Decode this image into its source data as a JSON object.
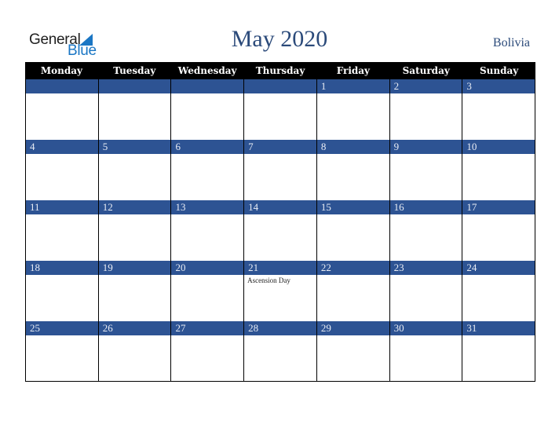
{
  "logo": {
    "general": "General",
    "blue": "Blue"
  },
  "title": "May 2020",
  "country": "Bolivia",
  "weekdays": [
    "Monday",
    "Tuesday",
    "Wednesday",
    "Thursday",
    "Friday",
    "Saturday",
    "Sunday"
  ],
  "weeks": [
    [
      {
        "d": ""
      },
      {
        "d": ""
      },
      {
        "d": ""
      },
      {
        "d": ""
      },
      {
        "d": "1"
      },
      {
        "d": "2"
      },
      {
        "d": "3"
      }
    ],
    [
      {
        "d": "4"
      },
      {
        "d": "5"
      },
      {
        "d": "6"
      },
      {
        "d": "7"
      },
      {
        "d": "8"
      },
      {
        "d": "9"
      },
      {
        "d": "10"
      }
    ],
    [
      {
        "d": "11"
      },
      {
        "d": "12"
      },
      {
        "d": "13"
      },
      {
        "d": "14"
      },
      {
        "d": "15"
      },
      {
        "d": "16"
      },
      {
        "d": "17"
      }
    ],
    [
      {
        "d": "18"
      },
      {
        "d": "19"
      },
      {
        "d": "20"
      },
      {
        "d": "21",
        "event": "Ascension Day"
      },
      {
        "d": "22"
      },
      {
        "d": "23"
      },
      {
        "d": "24"
      }
    ],
    [
      {
        "d": "25"
      },
      {
        "d": "26"
      },
      {
        "d": "27"
      },
      {
        "d": "28"
      },
      {
        "d": "29"
      },
      {
        "d": "30"
      },
      {
        "d": "31"
      }
    ]
  ],
  "colors": {
    "header_bg": "#000000",
    "band_bg": "#2d5393",
    "title": "#2b4a7a",
    "logo_blue": "#1a76c4"
  }
}
